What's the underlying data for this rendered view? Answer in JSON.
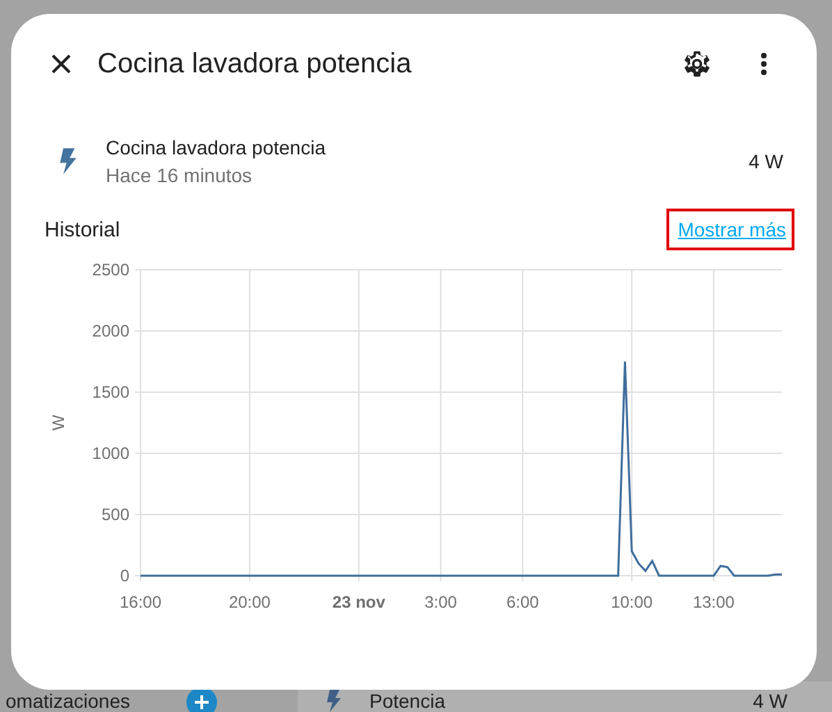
{
  "background": {
    "section_title": "omatizaciones",
    "entity_name": "Potencia",
    "entity_value": "4 W"
  },
  "dialog": {
    "title": "Cocina lavadora potencia",
    "entity": {
      "name": "Cocina lavadora potencia",
      "last_changed": "Hace 16 minutos",
      "state": "4 W"
    },
    "history": {
      "title": "Historial",
      "more_link": {
        "label": "Mostrar más",
        "highlighted": true
      },
      "chart_data": {
        "type": "line",
        "ylabel": "W",
        "categories": [
          "16:00",
          null,
          null,
          null,
          null,
          null,
          null,
          null,
          null,
          null,
          null,
          null,
          null,
          null,
          null,
          null,
          "20:00",
          null,
          null,
          null,
          null,
          null,
          null,
          null,
          null,
          null,
          null,
          null,
          null,
          null,
          null,
          null,
          "23 nov",
          null,
          null,
          null,
          null,
          null,
          null,
          null,
          null,
          null,
          null,
          null,
          "3:00",
          null,
          null,
          null,
          null,
          null,
          null,
          null,
          null,
          null,
          null,
          null,
          "6:00",
          null,
          null,
          null,
          null,
          null,
          null,
          null,
          null,
          null,
          null,
          null,
          null,
          null,
          null,
          null,
          "10:00",
          null,
          null,
          null,
          null,
          null,
          null,
          null,
          null,
          null,
          null,
          null,
          "13:00",
          null,
          null,
          null,
          null,
          null,
          null,
          null,
          null,
          null,
          null
        ],
        "series": [
          {
            "color": "#3f6e9c",
            "values": [
              0,
              0,
              0,
              0,
              0,
              0,
              0,
              0,
              0,
              0,
              0,
              0,
              0,
              0,
              0,
              0,
              0,
              0,
              0,
              0,
              0,
              0,
              0,
              0,
              0,
              0,
              0,
              0,
              0,
              0,
              0,
              0,
              0,
              0,
              0,
              0,
              0,
              0,
              0,
              0,
              0,
              0,
              0,
              0,
              0,
              0,
              0,
              0,
              0,
              0,
              0,
              0,
              0,
              0,
              0,
              0,
              0,
              0,
              0,
              0,
              0,
              0,
              0,
              0,
              0,
              0,
              0,
              0,
              0,
              0,
              0,
              1750,
              200,
              100,
              40,
              120,
              0,
              0,
              0,
              0,
              0,
              0,
              0,
              0,
              0,
              80,
              70,
              0,
              0,
              0,
              0,
              0,
              0,
              10,
              10
            ]
          }
        ],
        "ylim": [
          0,
          2500
        ],
        "grid": true,
        "yticks": [
          0,
          500,
          1000,
          1500,
          2000,
          2500
        ]
      }
    }
  }
}
